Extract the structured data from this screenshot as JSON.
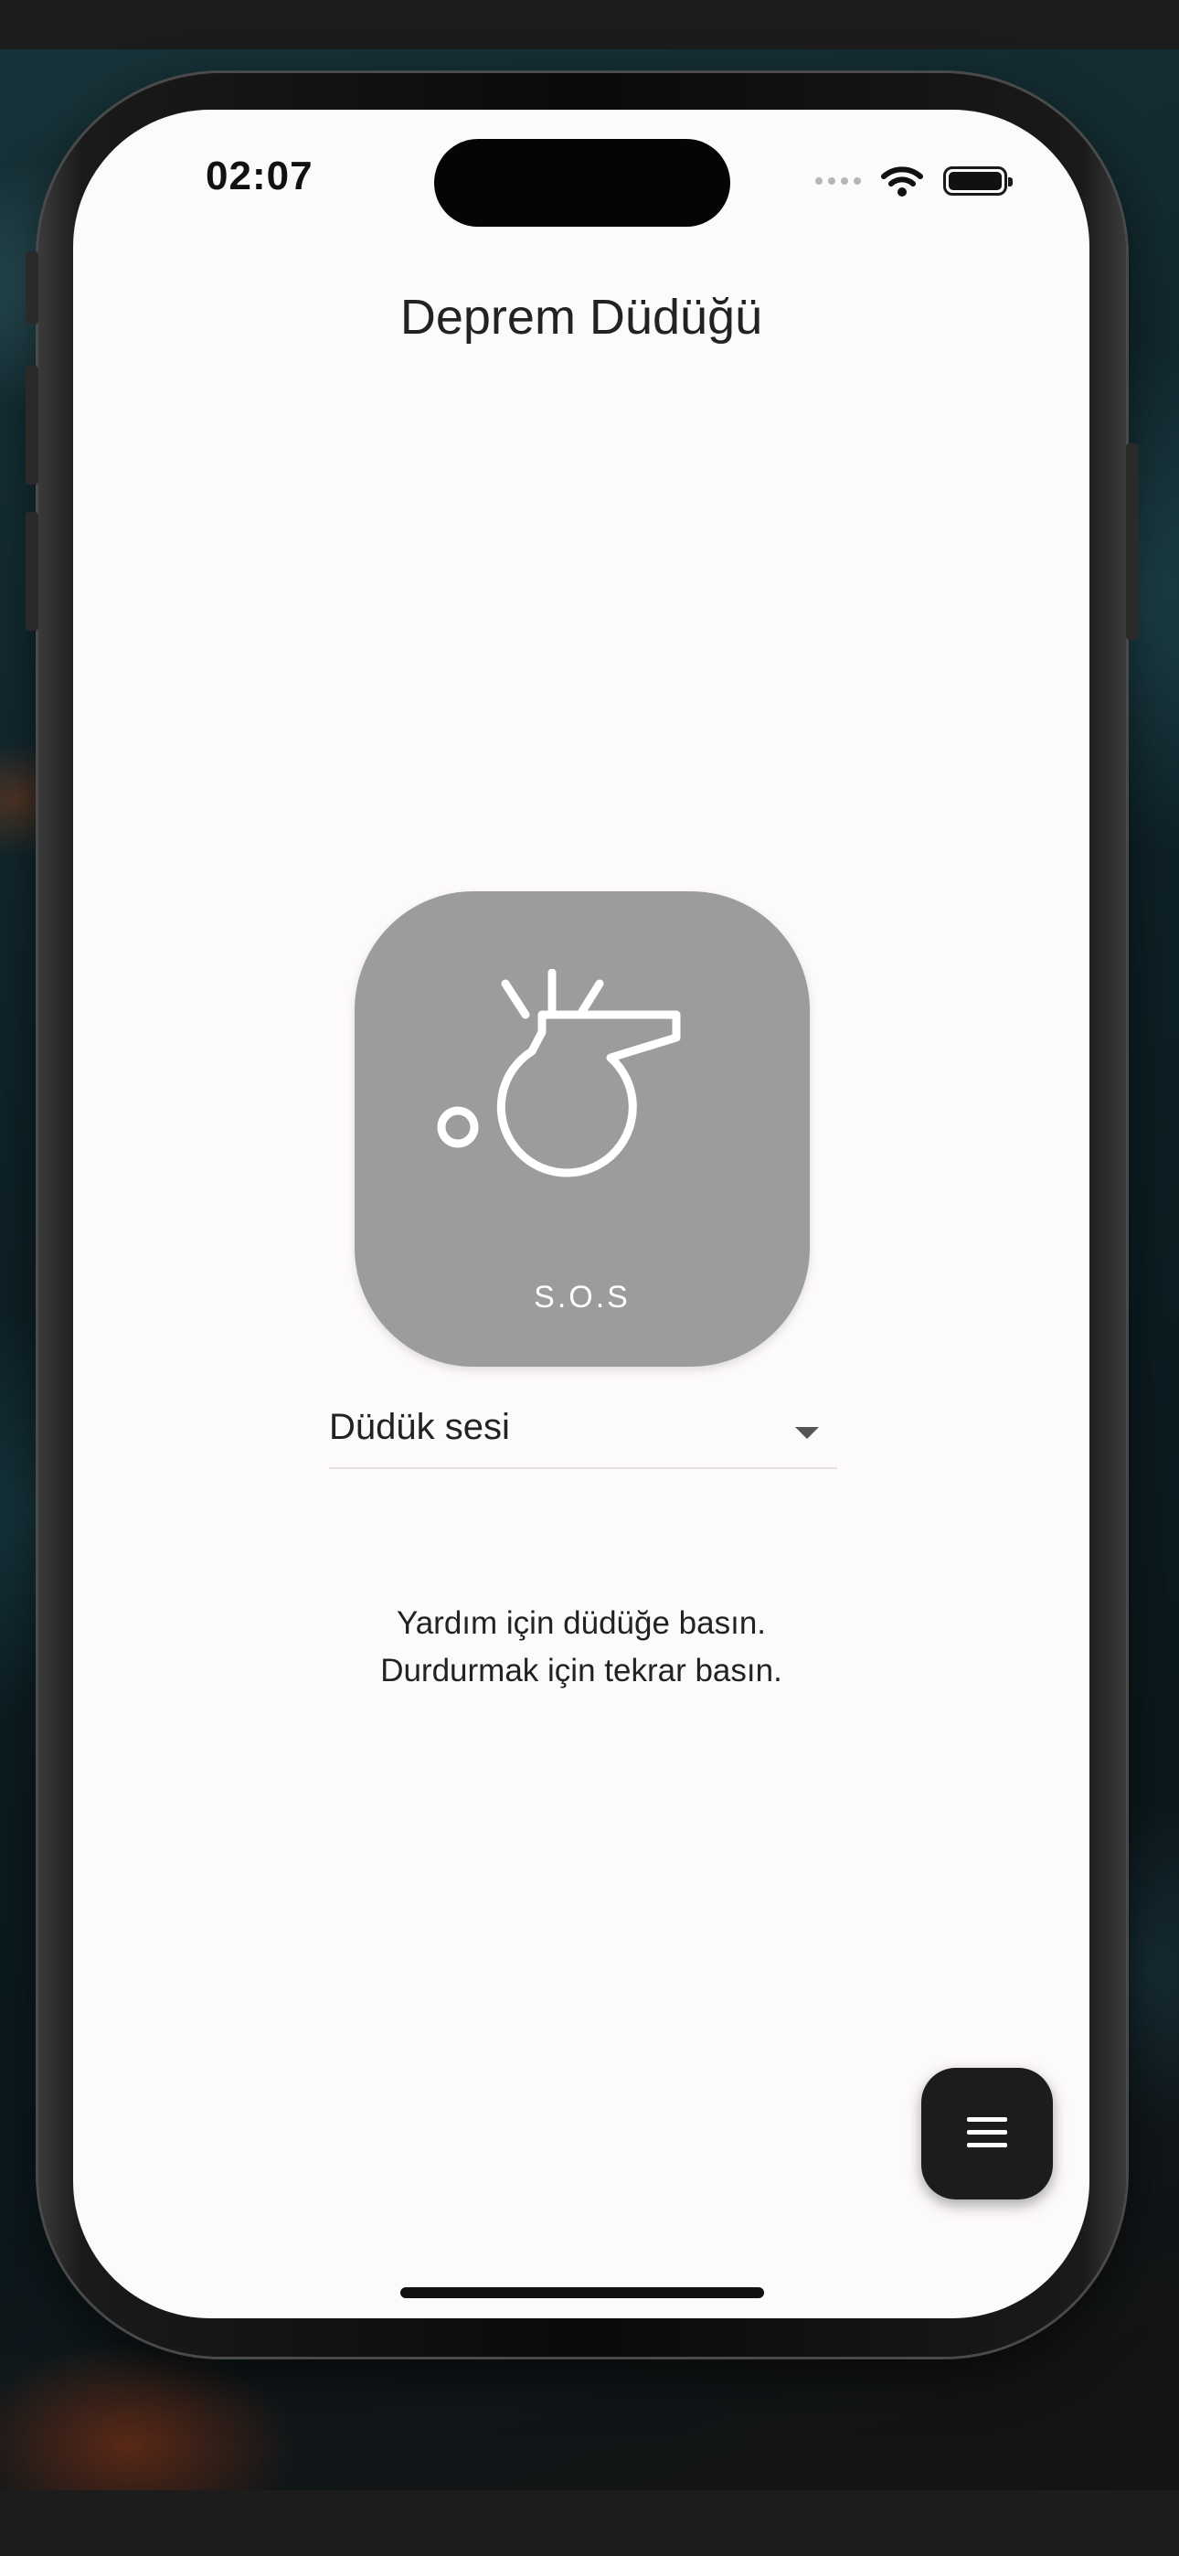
{
  "status_bar": {
    "time": "02:07"
  },
  "app": {
    "title": "Deprem Düdüğü"
  },
  "whistle_button": {
    "label": "S.O.S",
    "icon": "whistle-icon",
    "background_color": "#9c9b9e"
  },
  "sound_select": {
    "selected": "Düdük sesi"
  },
  "instructions": {
    "line1": "Yardım için düdüğe basın.",
    "line2": "Durdurmak için tekrar basın."
  },
  "fab": {
    "icon": "menu-icon",
    "background_color": "#1c1b1d"
  },
  "colors": {
    "screen_background": "#fdfafc"
  }
}
